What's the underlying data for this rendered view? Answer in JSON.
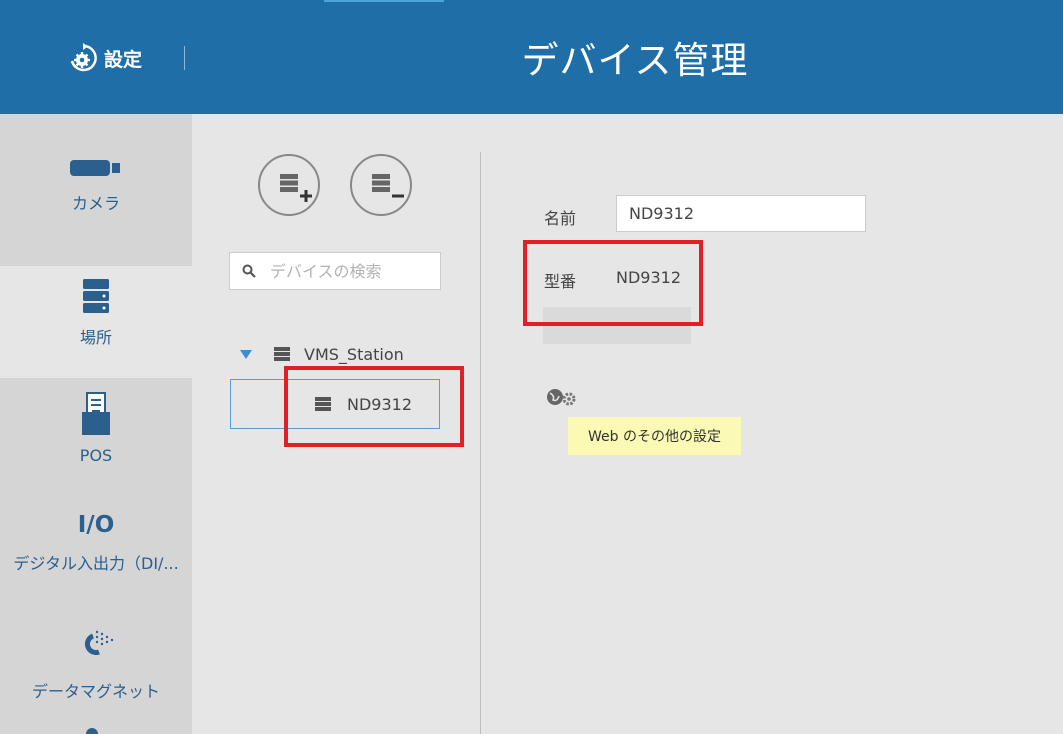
{
  "header": {
    "settings_label": "設定",
    "title": "デバイス管理"
  },
  "nav": {
    "items": [
      {
        "label": "カメラ",
        "icon": "camera-icon"
      },
      {
        "label": "場所",
        "icon": "location-icon",
        "active": true
      },
      {
        "label": "POS",
        "icon": "pos-icon"
      },
      {
        "label": "デジタル入出力（DI/...",
        "icon": "io-icon",
        "icon_text": "I/O"
      },
      {
        "label": "データマグネット",
        "icon": "data-magnet-icon"
      }
    ]
  },
  "tree": {
    "search_placeholder": "デバイスの検索",
    "root_label": "VMS_Station",
    "child_label": "ND9312",
    "add_button_icon": "add-device-icon",
    "remove_button_icon": "remove-device-icon"
  },
  "detail": {
    "name_label": "名前",
    "name_value": "ND9312",
    "model_label": "型番",
    "model_value": "ND9312",
    "hidden_button_label": "",
    "web_icon": "web-settings-icon",
    "tooltip": "Web のその他の設定"
  },
  "colors": {
    "header_bg": "#1f6ea8",
    "nav_bg": "#d5d5d5",
    "accent": "#2a5f8e",
    "highlight": "#e11f26",
    "tooltip_bg": "#fafab4"
  }
}
